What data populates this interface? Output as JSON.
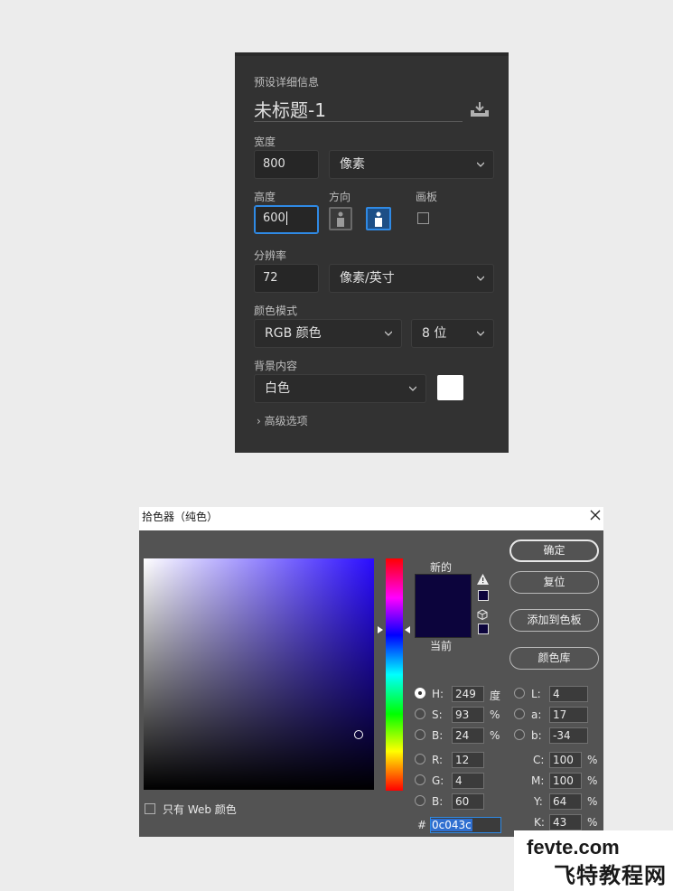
{
  "preset": {
    "header": "预设详细信息",
    "doc_name": "未标题-1",
    "width_label": "宽度",
    "width_value": "800",
    "width_unit": "像素",
    "height_label": "高度",
    "height_value": "600",
    "orientation_label": "方向",
    "artboard_label": "画板",
    "resolution_label": "分辨率",
    "resolution_value": "72",
    "resolution_unit": "像素/英寸",
    "color_mode_label": "颜色模式",
    "color_mode_value": "RGB 颜色",
    "bit_depth_value": "8 位",
    "background_label": "背景内容",
    "background_value": "白色",
    "background_swatch": "#ffffff",
    "advanced_label": "高级选项"
  },
  "picker": {
    "title": "拾色器（纯色）",
    "new_label": "新的",
    "current_label": "当前",
    "new_color": "#0c043c",
    "buttons": {
      "ok": "确定",
      "reset": "复位",
      "add_swatch": "添加到色板",
      "libraries": "颜色库"
    },
    "hsb": [
      {
        "label": "H:",
        "value": "249",
        "unit": "度",
        "selected": true
      },
      {
        "label": "S:",
        "value": "93",
        "unit": "%",
        "selected": false
      },
      {
        "label": "B:",
        "value": "24",
        "unit": "%",
        "selected": false
      }
    ],
    "rgb": [
      {
        "label": "R:",
        "value": "12"
      },
      {
        "label": "G:",
        "value": "4"
      },
      {
        "label": "B:",
        "value": "60"
      }
    ],
    "lab": [
      {
        "label": "L:",
        "value": "4"
      },
      {
        "label": "a:",
        "value": "17"
      },
      {
        "label": "b:",
        "value": "-34"
      }
    ],
    "cmyk": [
      {
        "label": "C:",
        "value": "100",
        "unit": "%"
      },
      {
        "label": "M:",
        "value": "100",
        "unit": "%"
      },
      {
        "label": "Y:",
        "value": "64",
        "unit": "%"
      },
      {
        "label": "K:",
        "value": "43",
        "unit": "%"
      }
    ],
    "hex_symbol": "#",
    "hex_value": "0c043c",
    "web_only_label": "只有 Web 颜色"
  },
  "watermark": {
    "line1": "fevte.com",
    "line2": "飞特教程网"
  }
}
